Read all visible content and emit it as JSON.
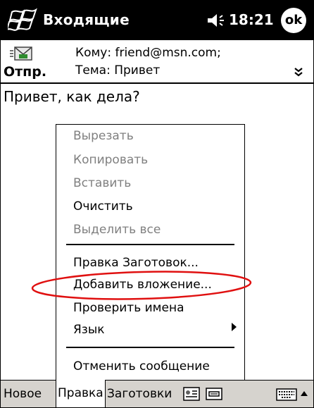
{
  "titlebar": {
    "app_title": "Входящие",
    "clock": "18:21",
    "ok_label": "ok",
    "start_icon": "windows-flag-icon",
    "volume_icon": "volume-icon"
  },
  "header": {
    "send_label": "Отпр.",
    "to_line": "Кому: friend@msn.com;",
    "subject_line": "Тема: Привет",
    "expand_icon": "double-chevron-down-icon"
  },
  "body": {
    "text": "Привет, как дела?"
  },
  "context_menu": {
    "cut": "Вырезать",
    "copy": "Копировать",
    "paste": "Вставить",
    "clear": "Очистить",
    "select_all": "Выделить все",
    "edit_templates": "Правка Заготовок...",
    "add_attachment": "Добавить вложение...",
    "check_names": "Проверить имена",
    "language": "Язык",
    "cancel_message": "Отменить сообщение",
    "highlight_color": "#e01010"
  },
  "menubar": {
    "new": "Новое",
    "edit": "Правка",
    "templates": "Заготовки"
  },
  "colors": {
    "titlebar_bg": "#000000",
    "menubar_bg": "#d6d3ce",
    "disabled_text": "#808080"
  }
}
